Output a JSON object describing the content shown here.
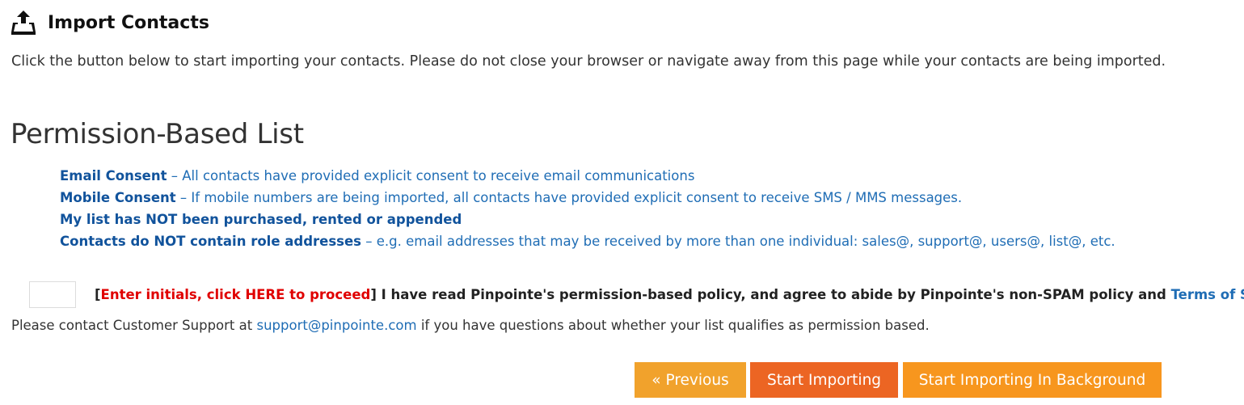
{
  "header": {
    "icon": "upload-tray-icon",
    "title": "Import Contacts"
  },
  "intro": "Click the button below to start importing your contacts. Please do not close your browser or navigate away from this page while your contacts are being imported.",
  "permission": {
    "title": "Permission-Based List",
    "items": [
      {
        "strong": "Email Consent",
        "rest": " – All contacts have provided explicit consent to receive email communications"
      },
      {
        "strong": "Mobile Consent",
        "rest": " – If mobile numbers are being imported, all contacts have provided explicit consent to receive SMS / MMS messages."
      },
      {
        "strong": "My list has NOT been purchased, rented or appended",
        "rest": ""
      },
      {
        "strong": "Contacts do NOT contain role addresses",
        "rest": " – e.g. email addresses that may be received by more than one individual: sales@, support@, users@, list@, etc."
      }
    ]
  },
  "agreement": {
    "initials_value": "",
    "initials_placeholder": "",
    "bracket_open": "[",
    "prompt": "Enter initials, click HERE to proceed",
    "bracket_close": "]",
    "text": " I have read Pinpointe's permission-based policy, and agree to abide by Pinpointe's non-SPAM policy and ",
    "tos_link": "Terms of Service",
    "period": "."
  },
  "support": {
    "before": "Please contact Customer Support at ",
    "email": "support@pinpointe.com",
    "after": " if you have questions about whether your list qualifies as permission based."
  },
  "buttons": {
    "previous": "« Previous",
    "start": "Start Importing",
    "background": "Start Importing In Background"
  },
  "colors": {
    "link": "#1f6db5",
    "prompt_red": "#e00000",
    "previous_button": "#f1a22c",
    "start_button": "#ec6523",
    "background_button": "#f7961e"
  }
}
